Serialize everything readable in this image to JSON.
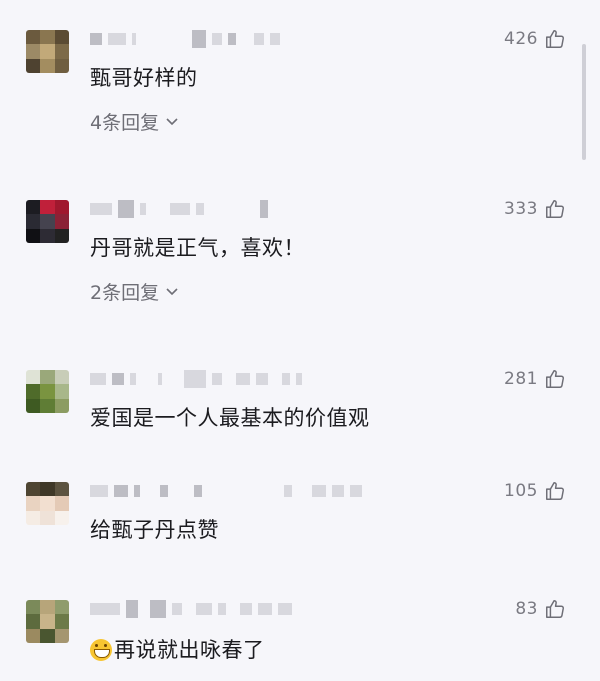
{
  "comments": [
    {
      "likes": "426",
      "text": "甄哥好样的",
      "replies_label": "4条回复"
    },
    {
      "likes": "333",
      "text": "丹哥就是正气，喜欢！",
      "replies_label": "2条回复"
    },
    {
      "likes": "281",
      "text": "爱国是一个人最基本的价值观"
    },
    {
      "likes": "105",
      "text": "给甄子丹点赞"
    },
    {
      "likes": "83",
      "text": "再说就出咏春了",
      "text_emoji": "grinning-face-emoji"
    }
  ],
  "icons": {
    "like": "thumbs-up-icon",
    "expand": "chevron-down-icon"
  },
  "colors": {
    "background": "#f6f6fa",
    "text": "#1b1b1f",
    "muted": "#7a7a82"
  }
}
